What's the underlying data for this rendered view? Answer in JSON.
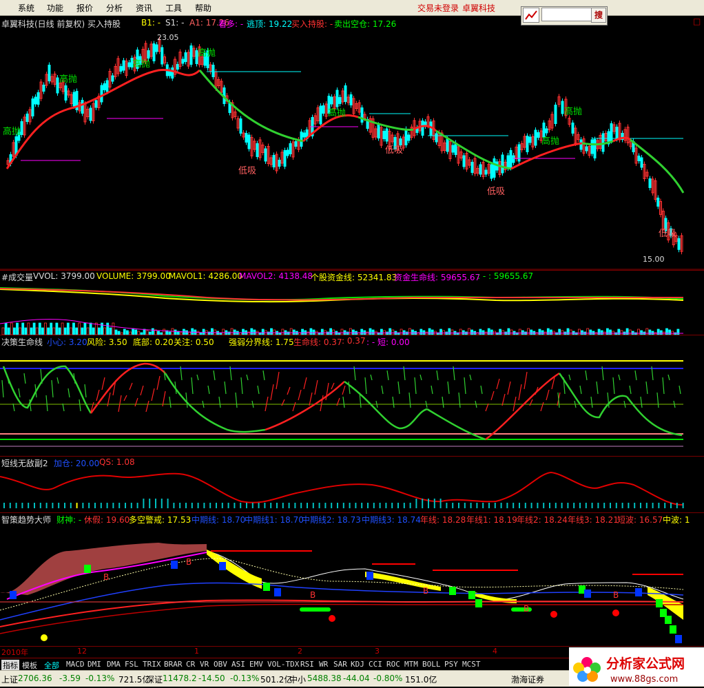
{
  "menu": {
    "items": [
      "系统",
      "功能",
      "报价",
      "分析",
      "资讯",
      "工具",
      "帮助"
    ],
    "status": "交易未登录",
    "brand": "卓翼科技",
    "search_btn": "搜",
    "search_value": ""
  },
  "main_panel": {
    "title": "卓翼科技(日线 前复权) 买入持股",
    "b1": "B1: -",
    "s1": "S1: -",
    "a1": "A1: 17.26",
    "kanduo": "看多: -",
    "taoding": "逃顶: 19.22",
    "mairu": "买入持股: -",
    "maichu": "卖出空仓: 17.26",
    "high_label": "23.05",
    "low_label": "15.00",
    "sell_tag": "高抛",
    "buy_tag": "低吸",
    "close_btn": "□"
  },
  "vol_panel": {
    "name": "#成交量",
    "vvol": "VVOL: 3799.00",
    "volume": "VOLUME: 3799.00",
    "mavol1": "MAVOL1: 4286.00",
    "mavol2": "MAVOL2: 4138.48",
    "zijin": "个股资金线: 52341.83",
    "shengming": "资金生命线: 59655.67",
    "extra": ": - : 59655.67"
  },
  "life_panel": {
    "name": "决策生命线",
    "xiaoxin": "小心: 3.20",
    "fengxian": "风险: 3.50",
    "dibu": "底部: 0.20",
    "guanzhu": "关注: 0.50",
    "qiangruo": "强弱分界线: 1.75",
    "shengming": "生命线: 0.37",
    "v2": ": 0.37",
    "duan": ": - 短: 0.00"
  },
  "short_panel": {
    "name": "短线无敌副2",
    "jiacang": "加仓: 20.00",
    "qs": "QS: 1.08"
  },
  "trend_panel": {
    "name": "智策趋势大师",
    "caishen": "财神: -",
    "xiujia": "休假: 19.60",
    "duokong": "多空警戒: 17.53",
    "zhongqi": "中期线: 18.70",
    "zq1": "中期线1: 18.70",
    "zq2": "中期线2: 18.73",
    "zq3": "中期线3: 18.74",
    "nian": "年线: 18.28",
    "nian1": "年线1: 18.19",
    "nian2": "年线2: 18.24",
    "nian3": "年线3: 18.21",
    "duanbo": "短波: 16.57",
    "zhongbo": "中波: 1",
    "b_mark": "B"
  },
  "date_axis": [
    "2010年",
    "12",
    "1",
    "2",
    "3",
    "4"
  ],
  "tabs": [
    "指标",
    "模板",
    "全部",
    "MACD",
    "DMI",
    "DMA",
    "FSL",
    "TRIX",
    "BRAR",
    "CR",
    "VR",
    "OBV",
    "ASI",
    "EMV",
    "VOL-TDX",
    "RSI",
    "WR",
    "SAR",
    "KDJ",
    "CCI",
    "ROC",
    "MTM",
    "BOLL",
    "PSY",
    "MCST"
  ],
  "status": {
    "sh": {
      "name": "上证",
      "value": "2706.36",
      "chg": "-3.59",
      "pct": "-0.13%",
      "amt": "721.5亿"
    },
    "sz": {
      "name": "深证",
      "value": "11478.2",
      "chg": "-14.50",
      "pct": "-0.13%",
      "amt": "501.2亿"
    },
    "zx": {
      "name": "中小",
      "value": "5488.38",
      "chg": "-44.04",
      "pct": "-0.80%",
      "amt": "151.0亿"
    },
    "broker": "渤海证券"
  },
  "watermark": {
    "text": "分析家公式网",
    "url": "www.88gs.com"
  },
  "colors": {
    "up": "#ff3232",
    "down": "#00ffff",
    "bg": "#000000",
    "axis": "#800000",
    "green": "#00e000",
    "yellow": "#ffff00",
    "magenta": "#ff00ff"
  }
}
